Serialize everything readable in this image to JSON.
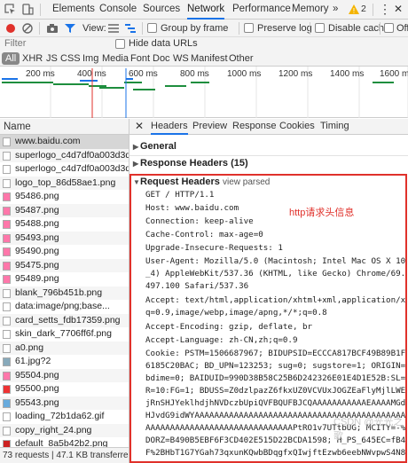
{
  "devtools_tabs": [
    "Elements",
    "Console",
    "Sources",
    "Network",
    "Performance",
    "Memory"
  ],
  "active_tab": "Network",
  "warning_count": "2",
  "toolbar": {
    "view_label": "View:",
    "group_by_frame": "Group by frame",
    "preserve_log": "Preserve log",
    "disable_cache": "Disable cache",
    "offline": "Offli"
  },
  "filter": {
    "placeholder": "Filter",
    "hide_data_urls": "Hide data URLs"
  },
  "type_filters": [
    "All",
    "XHR",
    "JS",
    "CSS",
    "Img",
    "Media",
    "Font",
    "Doc",
    "WS",
    "Manifest",
    "Other"
  ],
  "timeline_ticks": [
    "200 ms",
    "400 ms",
    "600 ms",
    "800 ms",
    "1000 ms",
    "1200 ms",
    "1400 ms",
    "1600 ms"
  ],
  "name_header": "Name",
  "requests": [
    "www.baidu.com",
    "superlogo_c4d7df0a003d3db...",
    "superlogo_c4d7df0a003d3db...",
    "logo_top_86d58ae1.png",
    "95486.png",
    "95487.png",
    "95488.png",
    "95493.png",
    "95490.png",
    "95475.png",
    "95489.png",
    "blank_796b451b.png",
    "data:image/png;base...",
    "card_setts_fdb17359.png",
    "skin_dark_7706ff6f.png",
    "a0.png",
    "61.jpg?2",
    "95504.png",
    "95500.png",
    "95543.png",
    "loading_72b1da62.gif",
    "copy_right_24.png",
    "default_8a5b42b2.png"
  ],
  "status_bar": "73 requests | 47.1 KB transferred ...",
  "detail_tabs": [
    "Headers",
    "Preview",
    "Response",
    "Cookies",
    "Timing"
  ],
  "sections": {
    "general": "General",
    "response_headers": "Response Headers (15)",
    "request_headers": "Request Headers",
    "view_parsed": "view parsed"
  },
  "annotation": "http请求头信息",
  "header_lines": [
    "GET / HTTP/1.1",
    "Host: www.baidu.com",
    "Connection: keep-alive",
    "Cache-Control: max-age=0",
    "Upgrade-Insecure-Requests: 1",
    "User-Agent: Mozilla/5.0 (Macintosh; Intel Mac OS X 10_12",
    "_4) AppleWebKit/537.36 (KHTML, like Gecko) Chrome/69.0.3",
    "497.100 Safari/537.36",
    "Accept: text/html,application/xhtml+xml,application/xml;",
    "q=0.9,image/webp,image/apng,*/*;q=0.8",
    "Accept-Encoding: gzip, deflate, br",
    "Accept-Language: zh-CN,zh;q=0.9",
    "Cookie: PSTM=1506687967; BIDUPSID=ECCCA817BCF49B89B1F19C",
    "6185C20BAC; BD_UPN=123253; sug=0; sugstore=1; ORIGIN=0;",
    "bdime=0; BAIDUID=990D38B58C25B6D242326E01E4D1E52B:SL=0:N",
    "R=10:FG=1; BDUSS=Z0dzlpazZ6fkxUZ0VCVUxJOGZEaFlyMjlLWElse",
    "jRnSHJYeklhdjhNVDczbUpiQVFBQUFBJCQAAAAAAAAAAAEAAAAMGd9Gc",
    "HJvdG9idWYAAAAAAAAAAAAAAAAAAAAAAAAAAAAAAAAAAAAAAAAAAAAA",
    "AAAAAAAAAAAAAAAAAAAAAAAAAAAAAAPtRO1v7UTtbUG; MCITY=-%3A; B",
    "DORZ=B490B5EBF6F3CD402E515D22BCDA1598; H_PS_645EC=fB4bV",
    "F%2BHbT1G7YGah73qxunKQwbBDqgfxQIwjftEzwb6eebNWvpwS4N8"
  ],
  "watermark": "CSDN @光光之歌"
}
